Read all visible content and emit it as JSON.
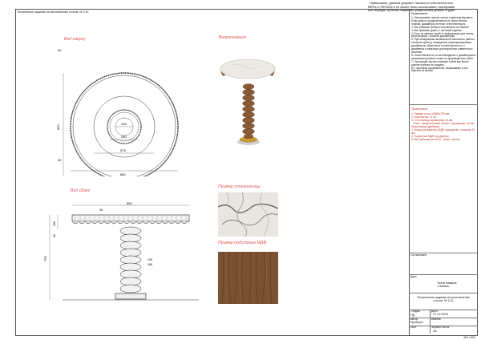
{
  "doc": {
    "title_top_left": "Техническое задание на изготовление столов  М 1:10",
    "header_notice": "Примечание, данный документ является собственностью\nMERILO DESIGN и не может быть использован, скопирован\nили передан третьим лицам без разрешения дизайн студии"
  },
  "views": {
    "top_view_label": "Вид сверху",
    "side_view_label": "Вид сбоку",
    "visualization_label": "Визуализация",
    "tabletop_example_label": "Пример столешницы",
    "base_example_label": "Пример подстолья МДФ"
  },
  "dims_top": {
    "d_outer": "860",
    "d_mid": "575",
    "d_inner": "280",
    "d_center": "145",
    "h_left": "560",
    "top_small": "60",
    "bottom_small": "60"
  },
  "dims_side": {
    "width": "860",
    "top_thk": "30",
    "h_total": "750",
    "h_a": "100",
    "h_b": "50",
    "d_col_a": "145",
    "d_col_b": "180"
  },
  "notes_header": "Примечание:",
  "notes_body": "1. Использовать чертеж только в цветном варианте. Если работы осуществляются по черно-белым планам, дизайнеры не несут ответственность\n2. Все размеры требуется проверить на объекте\n3. Все привязки даны от чистовой отделки\n4. Если не хватает какой-то информации для сметы, изготовления – вносить дизайнерам\n5. При обнаружении возможности выполнить работы, согласно проекту, немедленно проинформировать дизайнеров, обратиться в ответственность и дизайнеры и заказчика для выработки совместного решения\n6. Ответственность за несоблюдение с дизайнерами и заказчиком решения лежит на производителе работ\n7. Настоящий чертеж отменяет собой все более ранние чертежи по разделу\n8.С чертежом ознакомлены, запрашивать у нас, браться за пробки",
  "spec_header": "Примечание:",
  "spec_body": "1. Размер стола  Ø860х750 мм;\n2. Количество - 6 шт.\n3. Столешница мраморная 40 мм,\n   5 мм - закругленными стенки. под мрамор, 30 мм бешенковым дрейфом;\n4. Ножка (основание) МДФ под дерево, толщина 15 мм\n5. Подпятник МДФ под дерево;\n6. Все мебельные петли - абые  основе.",
  "titleblock": {
    "row_agreed": "Согласовано",
    "row_date": "Дата",
    "object": "Театр Камала\nг. Казань",
    "drawing_title": "Техническое задание на изготовление\nстолов  М 1:10",
    "stage_label": "Стадия",
    "stage_val": "РД",
    "date_label": "Дата",
    "date_val": "17.12.2024",
    "author_label": "Автор",
    "author_val": "Иванов",
    "check_label": "Проверил",
    "check_val": "",
    "format_label": "Формат листа",
    "format_val": "А3",
    "sheet_label": "Лист",
    "sheet_val": "",
    "size_label": "420 x 594"
  },
  "colors": {
    "marble": "#e9e6e1",
    "wood": "#7a5133",
    "wood_dark": "#5b3a22",
    "gold": "#c99a3a",
    "accent_red": "#d9534f"
  }
}
